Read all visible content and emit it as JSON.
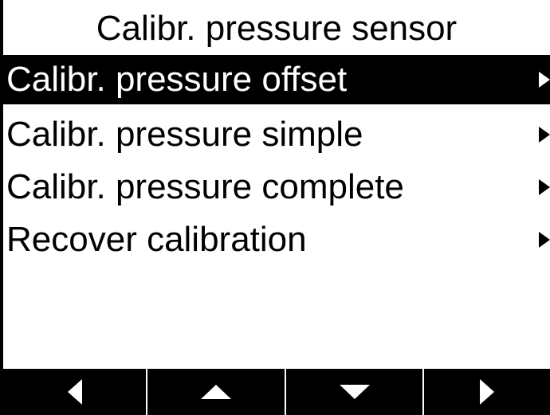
{
  "screen": {
    "title": "Calibr. pressure sensor"
  },
  "menu": {
    "items": [
      {
        "label": "Calibr. pressure offset",
        "selected": true,
        "icon": "submenu-arrow-icon"
      },
      {
        "label": "Calibr. pressure simple",
        "selected": false,
        "icon": "submenu-arrow-icon"
      },
      {
        "label": "Calibr. pressure complete",
        "selected": false,
        "icon": "submenu-arrow-icon"
      },
      {
        "label": "Recover calibration",
        "selected": false,
        "icon": "submenu-arrow-icon"
      }
    ]
  },
  "softkeys": [
    {
      "icon": "left-arrow-icon"
    },
    {
      "icon": "up-arrow-icon"
    },
    {
      "icon": "down-arrow-icon"
    },
    {
      "icon": "right-arrow-icon"
    }
  ],
  "colors": {
    "background": "#ffffff",
    "foreground": "#000000",
    "selection": "#000000"
  }
}
